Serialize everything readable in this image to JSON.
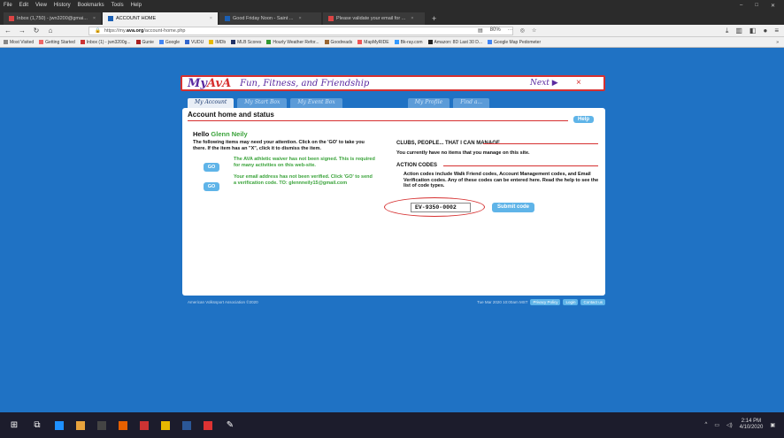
{
  "menubar": {
    "items": [
      "File",
      "Edit",
      "View",
      "History",
      "Bookmarks",
      "Tools",
      "Help"
    ]
  },
  "tabs": [
    {
      "label": "Inbox (1,750) - jwn3200@gmai...",
      "active": false
    },
    {
      "label": "ACCOUNT HOME",
      "active": true
    },
    {
      "label": "Good Friday Noon - Saint ...",
      "active": false
    },
    {
      "label": "Please validate your email for ...",
      "active": false
    }
  ],
  "url": {
    "prefix": "https://my.",
    "domain": "ava.org",
    "path": "/account-home.php",
    "zoom": "80%"
  },
  "bookmarks": [
    "Most Visited",
    "Getting Started",
    "Inbox (1) - jwn3200g...",
    "Gunie",
    "Google",
    "VUDU",
    "IMDb",
    "MLB Scores",
    "Hourly Weather Refor...",
    "Goodreads",
    "MapMyRIDE",
    "Bk-ray.com",
    "Amazon: 8D Last 30 D...",
    "Google Map Pedometer"
  ],
  "banner": {
    "logo_main": "My",
    "logo_accent": "AvA",
    "tagline": "Fun, Fitness, and Friendship",
    "next": "Next ▶",
    "close": "×"
  },
  "navtabs": [
    "My Account",
    "My Start Box",
    "My Event Box",
    "My Profile",
    "Find a..."
  ],
  "panel": {
    "title": "Account home and status",
    "help": "Help",
    "hello_prefix": "Hello ",
    "hello_name": "Glenn Neily",
    "attention": "The following items may need your attention. Click on the 'GO' to take you there. If the item has an \"X\", click it to dismiss the item.",
    "go": "GO",
    "warn1": "The AVA athletic waiver has not been signed. This is required for many activities on this web-site.",
    "warn2": "Your email address has not been verified. Click 'GO' to send a verification code. TO: glennneily15@gmail.com",
    "clubs_title": "CLUBS, PEOPLE... THAT I CAN MANAGE",
    "clubs_text": "You currently have no items that you manage on this site.",
    "codes_title": "ACTION CODES",
    "codes_text": "Action codes include Walk Friend codes, Account Management codes, and Email Verification codes. Any of these codes can be entered here. Read the help to see the list of code types.",
    "code_value": "EV-9350-0002",
    "submit": "Submit code"
  },
  "footer": {
    "left": "American Volkssport Association ©2020",
    "right_text": "Tue Mar 2020 10:00am MST",
    "privacy": "Privacy Policy",
    "login": "Login",
    "contact": "Contact us"
  },
  "tray": {
    "time": "2:14 PM",
    "date": "4/10/2020"
  }
}
